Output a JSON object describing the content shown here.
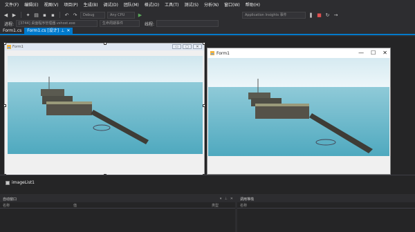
{
  "menu": [
    "文件(F)",
    "编辑(E)",
    "视图(V)",
    "项目(P)",
    "生成(B)",
    "调试(D)",
    "团队(M)",
    "格式(O)",
    "工具(T)",
    "测试(S)",
    "分析(N)",
    "窗口(W)",
    "帮助(H)"
  ],
  "toolbar": {
    "config_combo": "Debug",
    "platform_combo": "Any CPU",
    "app_insights": "Application Insights 事件"
  },
  "process_bar": {
    "label": "进程:",
    "process_value": "[3744] 桌面程序管理器.vshost.exe",
    "lifecycle_label": "生命周期事件",
    "thread_label": "线程:"
  },
  "tabs": [
    {
      "label": "Form1.cs",
      "active": false
    },
    {
      "label": "Form1.cs [设计]",
      "active": true
    }
  ],
  "design_form": {
    "title": "Form1",
    "buttons": [
      "▭",
      "▢",
      "✕"
    ]
  },
  "run_form": {
    "title": "Form1",
    "minimize": "—",
    "maximize": "☐",
    "close": "✕"
  },
  "tray": {
    "component": "imageList1"
  },
  "panels": {
    "auto_window": {
      "title": "自动窗口",
      "cols": [
        "名称",
        "值",
        "类型"
      ]
    },
    "call_stack": {
      "title": "调用堆栈",
      "cols": [
        "名称"
      ]
    }
  },
  "colors": {
    "accent": "#007acc",
    "ide_bg": "#2d2d30",
    "sea": "#5fb8cc",
    "sky": "#d9eef5"
  }
}
